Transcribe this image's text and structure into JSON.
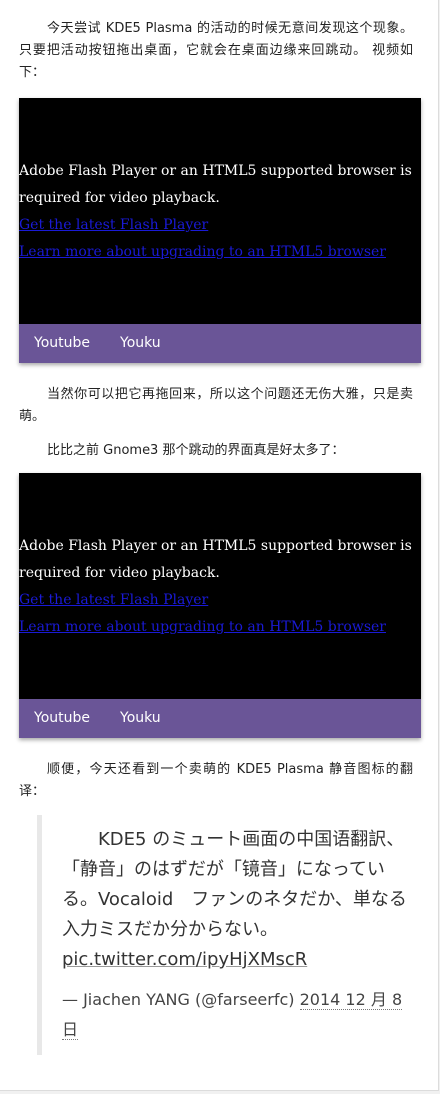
{
  "article": {
    "para1": "今天尝试 KDE5 Plasma 的活动的时候无意间发现这个现象。只要把活动按钮拖出桌面，它就会在桌面边缘来回跳动。 视频如下：",
    "para2": "当然你可以把它再拖回来，所以这个问题还无伤大雅，只是卖萌。",
    "para3": "比比之前 Gnome3 那个跳动的界面真是好太多了：",
    "para4": "顺便，今天还看到一个卖萌的 KDE5 Plasma 静音图标的翻译："
  },
  "video_player": {
    "message_line1": "Adobe Flash Player or an HTML5 supported browser is",
    "message_line2": "required for video playback.",
    "link_flash": "Get the latest Flash Player",
    "link_html5": "Learn more about upgrading to an HTML5 browser",
    "tabs": [
      "Youtube",
      "Youku"
    ]
  },
  "colors": {
    "tab_bar": "#6a5597",
    "link": "#1a1ad6"
  },
  "tweet": {
    "text": "KDE5 のミュート画面の中国语翻訳、「静音」のはずだが「镜音」になっている。Vocaloid　ファンのネタだか、単なる入力ミスだか分からない。",
    "link": "pic.twitter.com/ipyHjXMscR",
    "author": "— Jiachen YANG (@farseerfc)",
    "date": "2014 12 月 8 日"
  }
}
